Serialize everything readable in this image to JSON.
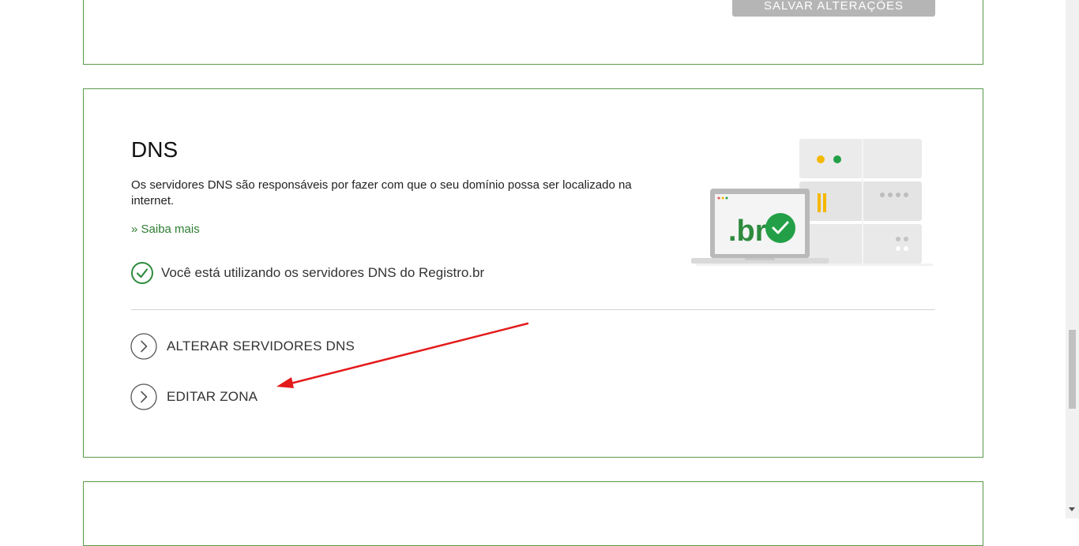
{
  "top_card": {
    "save_button": "SALVAR ALTERAÇÕES"
  },
  "dns": {
    "title": "DNS",
    "description": "Os servidores DNS são responsáveis por fazer com que o seu domínio possa ser localizado na internet.",
    "more_link": "» Saiba mais",
    "status_text": "Você está utilizando os servidores DNS do Registro.br",
    "actions": [
      {
        "label": "ALTERAR SERVIDORES DNS",
        "icon": "chevron-right-icon"
      },
      {
        "label": "EDITAR ZONA",
        "icon": "chevron-right-icon"
      }
    ],
    "illustration_text": ".br"
  },
  "colors": {
    "accent_green": "#2e7d32",
    "card_border": "#5a9a4a",
    "arrow_red": "#e31b1b"
  }
}
